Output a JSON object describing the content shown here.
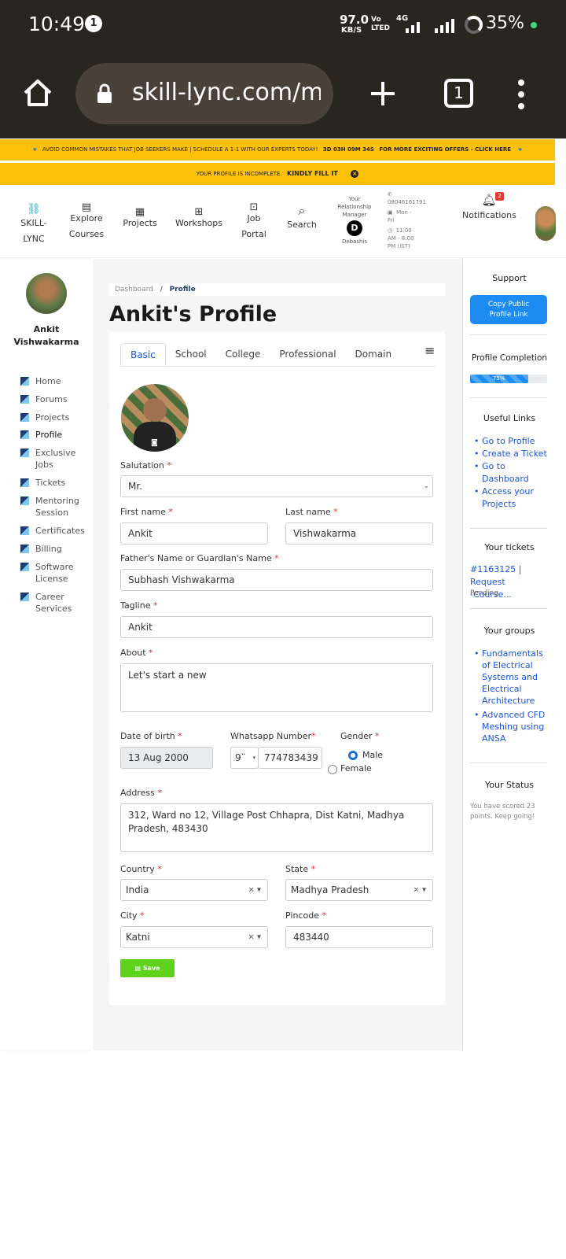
{
  "status_bar": {
    "time": "10:49",
    "notif_count": "1",
    "speed": "97.0",
    "speed_unit": "KB/S",
    "volte": "Vo LTED",
    "network": "4G",
    "battery": "35%"
  },
  "browser": {
    "url": "skill-lync.com/my",
    "tab_count": "1"
  },
  "banner1": {
    "text": "AVOID COMMON MISTAKES THAT JOB SEEKERS MAKE | SCHEDULE A 1-1 WITH OUR EXPERTS TODAY!",
    "countdown": "3D 03H 09M 34S",
    "cta": "FOR MORE EXCITING OFFERS - CLICK HERE"
  },
  "banner2": {
    "text": "YOUR PROFILE IS INCOMPLETE.",
    "cta": "KINDLY FILL IT"
  },
  "nav": {
    "logo_line1": "SKILL-",
    "logo_line2": "LYNC",
    "explore_line1": "Explore",
    "explore_line2": "Courses",
    "projects": "Projects",
    "workshops": "Workshops",
    "job_line1": "Job",
    "job_line2": "Portal",
    "search": "Search",
    "rm_line1": "Your",
    "rm_line2": "Relationship",
    "rm_line3": "Manager",
    "rm_initial": "D",
    "rm_name": "Debashis",
    "phone": "08046161791",
    "days_line1": "Mon -",
    "days_line2": "Fri",
    "hours_line1": "11:00",
    "hours_line2": "AM - 8:00",
    "hours_line3": "PM (IST)",
    "notifications": "Notifications",
    "notif_badge": "2"
  },
  "sidebar": {
    "name_line1": "Ankit",
    "name_line2": "Vishwakarma",
    "items": [
      {
        "label": "Home"
      },
      {
        "label": "Forums"
      },
      {
        "label": "Projects"
      },
      {
        "label": "Profile"
      },
      {
        "label": "Exclusive Jobs"
      },
      {
        "label": "Tickets"
      },
      {
        "label": "Mentoring Session"
      },
      {
        "label": "Certificates"
      },
      {
        "label": "Billing"
      },
      {
        "label": "Software License"
      },
      {
        "label": "Career Services"
      }
    ]
  },
  "breadcrumb": {
    "root": "Dashboard",
    "sep": "/",
    "current": "Profile"
  },
  "page_title": "Ankit's Profile",
  "tabs": [
    {
      "label": "Basic"
    },
    {
      "label": "School"
    },
    {
      "label": "College"
    },
    {
      "label": "Professional"
    },
    {
      "label": "Domain"
    }
  ],
  "form": {
    "salutation_label": "Salutation",
    "salutation_value": "Mr.",
    "first_name_label": "First name",
    "first_name_value": "Ankit",
    "last_name_label": "Last name",
    "last_name_value": "Vishwakarma",
    "father_label": "Father's Name or Guardian's Name",
    "father_value": "Subhash Vishwakarma",
    "tagline_label": "Tagline",
    "tagline_value": "Ankit",
    "about_label": "About",
    "about_value": "Let's start a new",
    "dob_label": "Date of birth",
    "dob_value": "13 Aug 2000",
    "whatsapp_label": "Whatsapp Number",
    "whatsapp_code": "9¨",
    "whatsapp_value": "774783439",
    "gender_label": "Gender",
    "gender_male": "Male",
    "gender_female": "Female",
    "address_label": "Address",
    "address_value": "312, Ward no 12, Village Post Chhapra, Dist Katni, Madhya Pradesh, 483430",
    "country_label": "Country",
    "country_value": "India",
    "state_label": "State",
    "state_value": "Madhya Pradesh",
    "city_label": "City",
    "city_value": "Katni",
    "pincode_label": "Pincode",
    "pincode_value": "483440",
    "save_label": "Save"
  },
  "right": {
    "support_title": "Support",
    "copy_line1": "Copy Public",
    "copy_line2": "Profile Link",
    "completion_title": "Profile Completion",
    "completion_text": "75%",
    "completion_value": 75,
    "useful_title": "Useful Links",
    "link1": "Go to Profile",
    "link2": "Create a Ticket",
    "link3_line1": "Go to",
    "link3_line2": "Dashboard",
    "link4_line1": "Access your",
    "link4_line2": "Projects",
    "tickets_title": "Your tickets",
    "ticket_id": "#1163125",
    "ticket_sep": "|",
    "ticket_line1": "Request",
    "ticket_line2": "-Course...",
    "ticket_status": "Pending",
    "groups_title": "Your groups",
    "group1": [
      "Fundamentals",
      "of Electrical",
      "Systems and",
      "Electrical",
      "Architecture"
    ],
    "group2": [
      "Advanced CFD",
      "Meshing using",
      "ANSA"
    ],
    "status_title": "Your Status",
    "status_line1": "You have scored 23",
    "status_line2": "points. Keep going!"
  },
  "colors": {
    "banner": "#ffc107",
    "primary": "#1e8bf0",
    "save": "#5fd21d",
    "link": "#1a56db"
  }
}
